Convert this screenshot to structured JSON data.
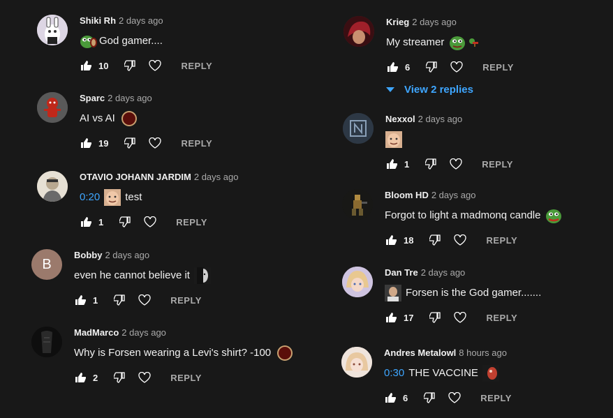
{
  "left_column": [
    {
      "author": "Shiki Rh",
      "time": "2 days ago",
      "text": "God gamer....",
      "likes": "10",
      "reply": "REPLY",
      "avatar_color": "#e8e0e8"
    },
    {
      "author": "Sparc",
      "time": "2 days ago",
      "text": "AI vs AI",
      "likes": "19",
      "reply": "REPLY",
      "avatar_color": "#5a5a5a"
    },
    {
      "author": "OTAVIO JOHANN JARDIM",
      "time": "2 days ago",
      "timestamp": "0:20",
      "text": "test",
      "likes": "1",
      "reply": "REPLY",
      "avatar_color": "#c9b9a0"
    },
    {
      "author": "Bobby",
      "time": "2 days ago",
      "text": "even he cannot believe it",
      "likes": "1",
      "reply": "REPLY",
      "avatar_letter": "B",
      "avatar_color": "#9b7a6c"
    },
    {
      "author": "MadMarco",
      "time": "2 days ago",
      "text": "Why is Forsen wearing a Levi's shirt? -100",
      "likes": "2",
      "reply": "REPLY",
      "avatar_color": "#111111"
    }
  ],
  "right_column": [
    {
      "author": "Krieg",
      "time": "2 days ago",
      "text": "My streamer",
      "likes": "6",
      "reply": "REPLY",
      "view_replies": "View 2 replies",
      "avatar_color": "#7a1e24"
    },
    {
      "author": "Nexxol",
      "time": "2 days ago",
      "text": "",
      "likes": "1",
      "reply": "REPLY",
      "avatar_color": "#2e3a48"
    },
    {
      "author": "Bloom HD",
      "time": "2 days ago",
      "text": "Forgot to light a madmonq candle",
      "likes": "18",
      "reply": "REPLY",
      "avatar_color": "#2a2a20"
    },
    {
      "author": "Dan Tre",
      "time": "2 days ago",
      "text": "Forsen is the God gamer.......",
      "likes": "17",
      "reply": "REPLY",
      "avatar_color": "#c8b8d8"
    },
    {
      "author": "Andres Metalowl",
      "time": "8 hours ago",
      "timestamp": "0:30",
      "text": "THE VACCINE",
      "likes": "6",
      "reply": "REPLY",
      "avatar_color": "#e8d8d0"
    }
  ],
  "colors": {
    "background": "#181818",
    "link": "#3ea6ff",
    "meta": "#aaaaaa",
    "text": "#f1f1f1"
  }
}
